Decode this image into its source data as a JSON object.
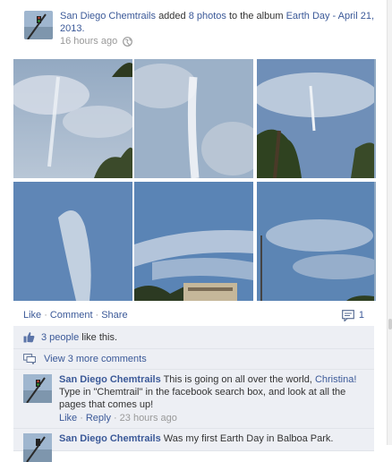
{
  "story": {
    "actor": "San Diego Chemtrails",
    "verb_before_count": "added",
    "photo_count_text": "8 photos",
    "verb_after_count": "to the album",
    "album_name": "Earth Day - April 21, 2013.",
    "timestamp": "16 hours ago",
    "privacy_icon": "globe-icon"
  },
  "actions": {
    "like": "Like",
    "comment": "Comment",
    "share": "Share",
    "separator": "·",
    "comment_count": "1",
    "comment_icon": "comment-icon"
  },
  "likes": {
    "count_link": "3 people",
    "suffix": "like this.",
    "icon": "thumbs-up-icon"
  },
  "more_comments": {
    "label": "View 3 more comments",
    "icon": "comments-icon"
  },
  "comments": [
    {
      "author": "San Diego Chemtrails",
      "text_before": "This is going on all over the world,",
      "mention": "Christina!",
      "text_after": "Type in \"Chemtrail\" in the facebook search box, and look at all the pages that comes up!",
      "like": "Like",
      "reply": "Reply",
      "time": "23 hours ago"
    },
    {
      "author": "San Diego Chemtrails",
      "text": "Was my first Earth Day in Balboa Park."
    }
  ],
  "colors": {
    "link": "#3b5998",
    "ufi_background": "#edeff4",
    "meta_text": "#999999"
  }
}
